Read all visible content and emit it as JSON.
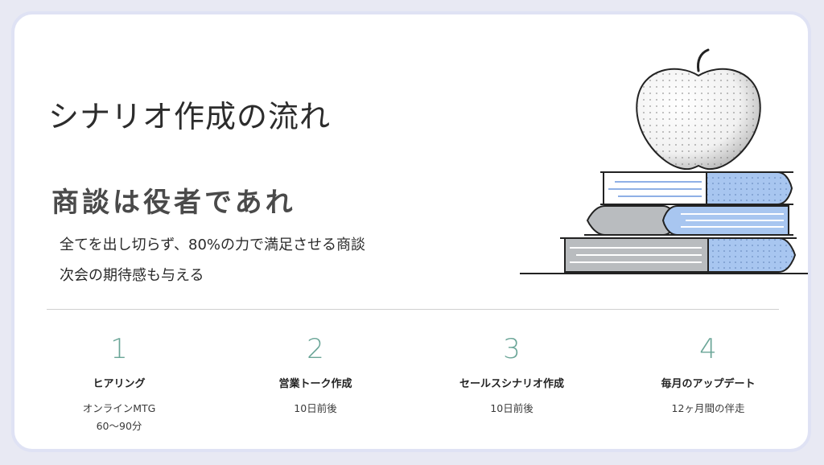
{
  "slide": {
    "title": "シナリオ作成の流れ",
    "subtitle": "商談は役者であれ",
    "description": [
      "全てを出し切らず、80%の力で満足させる商談",
      "次会の期待感も与える"
    ]
  },
  "steps": [
    {
      "number": "1",
      "title": "ヒアリング",
      "desc": [
        "オンラインMTG",
        "60〜90分"
      ]
    },
    {
      "number": "2",
      "title": "営業トーク作成",
      "desc": [
        "10日前後"
      ]
    },
    {
      "number": "3",
      "title": "セールスシナリオ作成",
      "desc": [
        "10日前後"
      ]
    },
    {
      "number": "4",
      "title": "毎月のアップデート",
      "desc": [
        "12ヶ月間の伴走"
      ]
    }
  ],
  "illustration": {
    "icon": "apple-on-books-icon",
    "colors": {
      "accent_blue": "#a8c6f0",
      "gray": "#b9bcbf",
      "outline": "#222222",
      "step_number": "#6aa597"
    }
  }
}
